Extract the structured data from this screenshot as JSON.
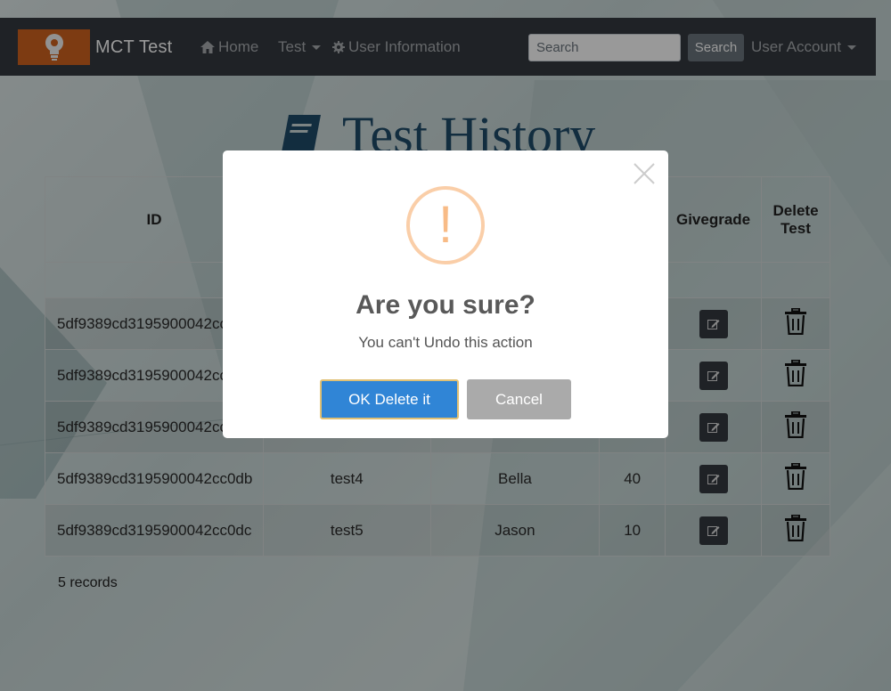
{
  "navbar": {
    "brand": "MCT Test",
    "home_label": "Home",
    "test_label": "Test",
    "user_info_label": "User Information",
    "search_placeholder": "Search",
    "search_button": "Search",
    "account_label": "User Account"
  },
  "page": {
    "title": "Test History"
  },
  "table": {
    "headers": {
      "id": "ID",
      "givegrade": "Givegrade",
      "delete": "Delete Test"
    },
    "rows": [
      {
        "id": "5df9389cd3195900042cc",
        "test": "",
        "name": "",
        "score": ""
      },
      {
        "id": "5df9389cd3195900042cc",
        "test": "",
        "name": "",
        "score": ""
      },
      {
        "id": "5df9389cd3195900042cc",
        "test": "",
        "name": "",
        "score": ""
      },
      {
        "id": "5df9389cd3195900042cc0db",
        "test": "test4",
        "name": "Bella",
        "score": "40"
      },
      {
        "id": "5df9389cd3195900042cc0dc",
        "test": "test5",
        "name": "Jason",
        "score": "10"
      }
    ],
    "records_text": "5 records"
  },
  "dialog": {
    "icon": "!",
    "title": "Are you sure?",
    "text": "You can't Undo this action",
    "confirm_label": "OK Delete it",
    "cancel_label": "Cancel"
  },
  "colors": {
    "navbar": "#343a40",
    "brand_logo": "#d0631e",
    "confirm_button": "#3085d6",
    "cancel_button": "#aaaaaa",
    "warning": "#f8bb86"
  }
}
